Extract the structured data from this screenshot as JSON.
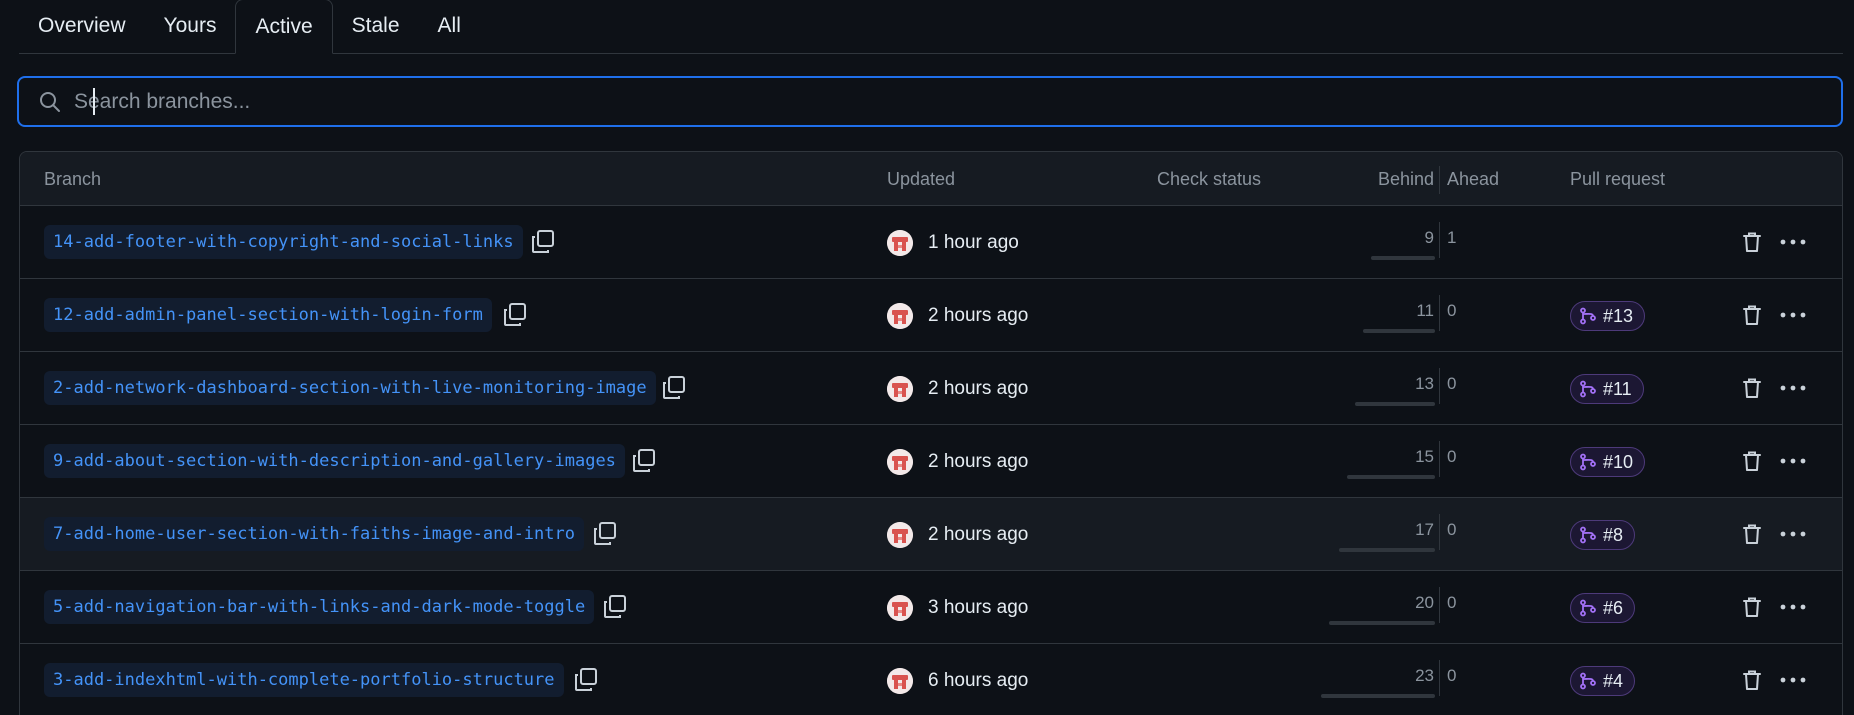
{
  "tabs": [
    "Overview",
    "Yours",
    "Active",
    "Stale",
    "All"
  ],
  "active_tab": "Active",
  "search": {
    "placeholder": "Search branches..."
  },
  "table": {
    "headers": {
      "branch": "Branch",
      "updated": "Updated",
      "check_status": "Check status",
      "behind": "Behind",
      "ahead": "Ahead",
      "pull_request": "Pull request"
    },
    "rows": [
      {
        "branch": "14-add-footer-with-copyright-and-social-links",
        "updated": "1 hour ago",
        "behind": "9",
        "ahead": "1",
        "pr": ""
      },
      {
        "branch": "12-add-admin-panel-section-with-login-form",
        "updated": "2 hours ago",
        "behind": "11",
        "ahead": "0",
        "pr": "#13"
      },
      {
        "branch": "2-add-network-dashboard-section-with-live-monitoring-image",
        "updated": "2 hours ago",
        "behind": "13",
        "ahead": "0",
        "pr": "#11"
      },
      {
        "branch": "9-add-about-section-with-description-and-gallery-images",
        "updated": "2 hours ago",
        "behind": "15",
        "ahead": "0",
        "pr": "#10"
      },
      {
        "branch": "7-add-home-user-section-with-faiths-image-and-intro",
        "updated": "2 hours ago",
        "behind": "17",
        "ahead": "0",
        "pr": "#8"
      },
      {
        "branch": "5-add-navigation-bar-with-links-and-dark-mode-toggle",
        "updated": "3 hours ago",
        "behind": "20",
        "ahead": "0",
        "pr": "#6"
      },
      {
        "branch": "3-add-indexhtml-with-complete-portfolio-structure",
        "updated": "6 hours ago",
        "behind": "23",
        "ahead": "0",
        "pr": "#4"
      }
    ]
  },
  "colors": {
    "background": "#0d1117",
    "accent": "#1f6feb",
    "link": "#4493f8",
    "border": "#30363d",
    "pr_icon": "#a371f7"
  },
  "icons": {
    "search": "search-icon",
    "copy": "copy-icon",
    "avatar": "avatar",
    "pull_request": "git-pull-request-icon",
    "delete": "trash-icon",
    "more": "kebab-horizontal-icon"
  }
}
